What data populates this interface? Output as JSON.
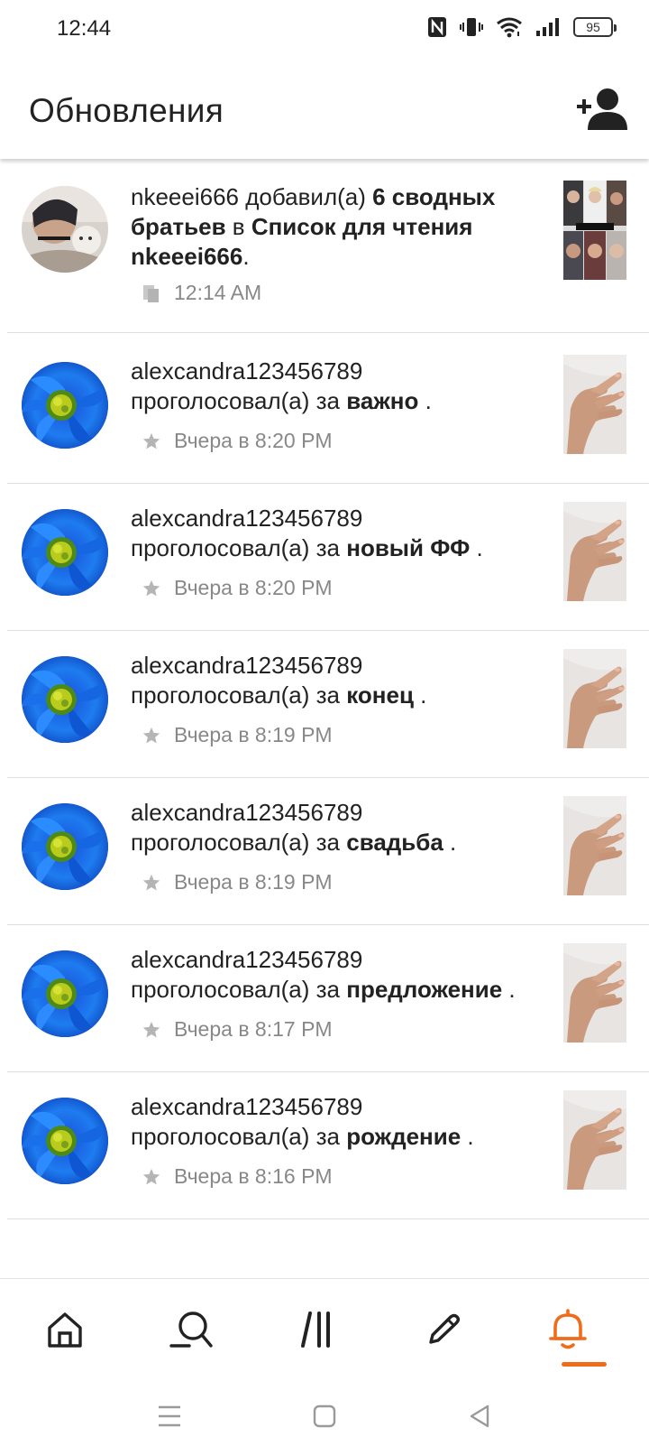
{
  "status_bar": {
    "time": "12:44",
    "battery": "95"
  },
  "header": {
    "title": "Обновления",
    "add_friend_icon": "add-person-icon"
  },
  "feed": {
    "items": [
      {
        "parts": [
          {
            "text": "nkeeei666",
            "strong": false
          },
          {
            "text": " добавил(а) ",
            "strong": false
          },
          {
            "text": "6 сводных братьев",
            "strong": true
          },
          {
            "text": " в ",
            "strong": false
          },
          {
            "text": "Список для чтения nkeeei666",
            "strong": true
          },
          {
            "text": ".",
            "strong": false
          }
        ],
        "meta_icon": "reading-list-icon",
        "time": "12:14 AM",
        "avatar": "user-photo",
        "thumb": "collage"
      },
      {
        "user": "alexcandra123456789",
        "action": "проголосовал(а) за ",
        "story": "важно",
        "end": " .",
        "meta_icon": "star-icon",
        "time": "Вчера в 8:20 PM"
      },
      {
        "user": "alexcandra123456789",
        "action": "проголосовал(а) за ",
        "story": "новый ФФ",
        "end": " .",
        "meta_icon": "star-icon",
        "time": "Вчера в 8:20 PM"
      },
      {
        "user": "alexcandra123456789",
        "action": "проголосовал(а) за ",
        "story": "конец",
        "end": " .",
        "meta_icon": "star-icon",
        "time": "Вчера в 8:19 PM"
      },
      {
        "user": "alexcandra123456789",
        "action": "проголосовал(а) за ",
        "story": "свадьба",
        "end": " .",
        "meta_icon": "star-icon",
        "time": "Вчера в 8:19 PM"
      },
      {
        "user": "alexcandra123456789",
        "action": "проголосовал(а) за ",
        "story": "предложение",
        "end": " .",
        "meta_icon": "star-icon",
        "time": "Вчера в 8:17 PM"
      },
      {
        "user": "alexcandra123456789",
        "action": "проголосовал(а) за ",
        "story": "рождение",
        "end": " .",
        "meta_icon": "star-icon",
        "time": "Вчера в 8:16 PM"
      }
    ]
  },
  "bottom_nav": {
    "items": [
      {
        "icon": "home-icon",
        "active": false
      },
      {
        "icon": "search-icon",
        "active": false
      },
      {
        "icon": "library-icon",
        "active": false
      },
      {
        "icon": "write-icon",
        "active": false
      },
      {
        "icon": "notifications-icon",
        "active": true
      }
    ],
    "active_color": "#ef6c1a",
    "inactive_color": "#222222"
  },
  "system_nav": {
    "items": [
      "recents-icon",
      "home-square-icon",
      "back-triangle-icon"
    ]
  },
  "colors": {
    "accent": "#ef6c1a",
    "meta_text": "#888888",
    "text": "#222222",
    "divider": "#dedede"
  }
}
